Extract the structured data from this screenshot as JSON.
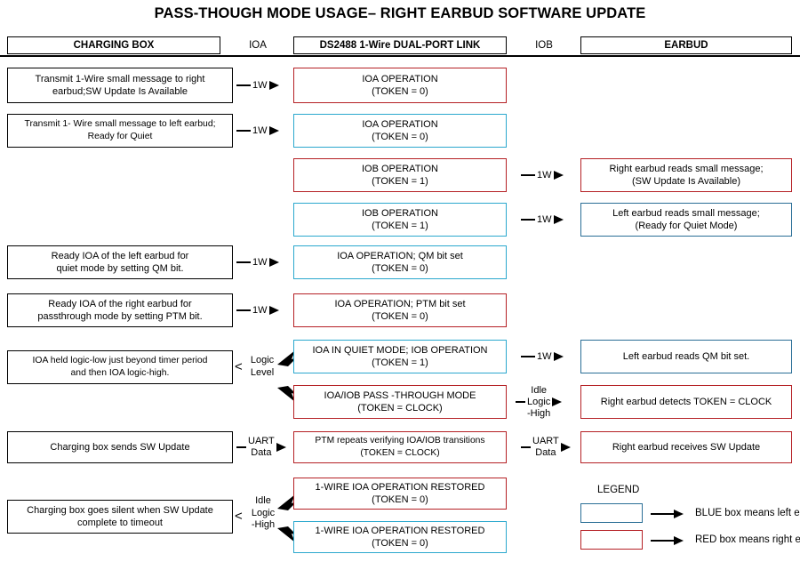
{
  "title": "PASS-THOUGH MODE USAGE– RIGHT EARBUD SOFTWARE UPDATE",
  "header": {
    "charging_box": "CHARGING BOX",
    "ioa": "IOA",
    "link": "DS2488 1-Wire DUAL-PORT LINK",
    "iob": "IOB",
    "earbud": "EARBUD"
  },
  "colors": {
    "red": "#B52025",
    "cyan": "#2BA8CE",
    "steel": "#2A6E96",
    "black": "#000000",
    "background": "#FFFFFF"
  },
  "rows": [
    {
      "left": {
        "line1": "Transmit 1-Wire small message to right",
        "line2": "earbud;SW Update Is Available",
        "color": "black"
      },
      "conn_left": {
        "label": "1W"
      },
      "middle": {
        "line1": "IOA OPERATION",
        "line2": "(TOKEN = 0)",
        "color": "red"
      },
      "conn_right": null,
      "right": null
    },
    {
      "left": {
        "line1": "Transmit 1- Wire small message to left earbud;",
        "line2": "Ready for Quiet",
        "color": "black"
      },
      "conn_left": {
        "label": "1W"
      },
      "middle": {
        "line1": "IOA OPERATION",
        "line2": "(TOKEN = 0)",
        "color": "cyan"
      },
      "conn_right": null,
      "right": null
    },
    {
      "left": null,
      "conn_left": null,
      "middle": {
        "line1": "IOB OPERATION",
        "line2": "(TOKEN = 1)",
        "color": "red"
      },
      "conn_right": {
        "label": "1W"
      },
      "right": {
        "line1": "Right earbud reads small message;",
        "line2": "(SW Update Is Available)",
        "color": "red"
      }
    },
    {
      "left": null,
      "conn_left": null,
      "middle": {
        "line1": "IOB OPERATION",
        "line2": "(TOKEN = 1)",
        "color": "cyan"
      },
      "conn_right": {
        "label": "1W"
      },
      "right": {
        "line1": "Left earbud reads small message;",
        "line2": "(Ready for Quiet Mode)",
        "color": "steel"
      }
    },
    {
      "left": {
        "line1": "Ready IOA of the left earbud for",
        "line2": "quiet mode by setting QM bit.",
        "color": "black"
      },
      "conn_left": {
        "label": "1W"
      },
      "middle": {
        "line1": "IOA OPERATION; QM bit set",
        "line2": "(TOKEN = 0)",
        "color": "cyan"
      },
      "conn_right": null,
      "right": null
    },
    {
      "left": {
        "line1": "Ready IOA of the right earbud for",
        "line2": "passthrough mode by setting PTM bit.",
        "color": "black"
      },
      "conn_left": {
        "label": "1W"
      },
      "middle": {
        "line1": "IOA OPERATION; PTM bit set",
        "line2": "(TOKEN = 0)",
        "color": "red"
      },
      "conn_right": null,
      "right": null
    }
  ],
  "branch_group_1": {
    "left_box": {
      "line1": "IOA held logic-low just beyond timer period",
      "line2": "and then IOA logic-high.",
      "color": "black"
    },
    "marker": "<",
    "label_lines": [
      "Logic",
      "Level"
    ],
    "top": {
      "middle": {
        "line1": "IOA IN QUIET MODE; IOB OPERATION",
        "line2": "(TOKEN = 1)",
        "color": "cyan"
      },
      "conn_right": {
        "label": "1W"
      },
      "right": {
        "line1": "Left earbud reads QM bit set.",
        "line2": "",
        "color": "steel"
      }
    },
    "bottom": {
      "middle": {
        "line1": "IOA/IOB PASS -THROUGH MODE",
        "line2": "(TOKEN = CLOCK)",
        "color": "red"
      },
      "conn_right": {
        "label_lines": [
          "Idle",
          "Logic",
          "-High"
        ]
      },
      "right": {
        "line1": "Right earbud detects TOKEN = CLOCK",
        "line2": "",
        "color": "red"
      }
    }
  },
  "uart_row": {
    "left": {
      "line1": "Charging box sends SW Update",
      "line2": "",
      "color": "black"
    },
    "conn_left": {
      "label_lines": [
        "UART",
        "Data"
      ]
    },
    "middle": {
      "line1": "PTM repeats verifying IOA/IOB transitions",
      "line2": "(TOKEN = CLOCK)",
      "color": "red"
    },
    "conn_right": {
      "label_lines": [
        "UART",
        "Data"
      ]
    },
    "right": {
      "line1": "Right earbud receives  SW Update",
      "line2": "",
      "color": "red"
    }
  },
  "branch_group_2": {
    "left_box": {
      "line1": "Charging box goes silent when SW Update",
      "line2": "complete to timeout",
      "color": "black"
    },
    "marker": "<",
    "label_lines": [
      "Idle",
      "Logic",
      "-High"
    ],
    "top": {
      "middle": {
        "line1": "1-WIRE IOA OPERATION RESTORED",
        "line2": "(TOKEN = 0)",
        "color": "red"
      }
    },
    "bottom": {
      "middle": {
        "line1": "1-WIRE IOA OPERATION RESTORED",
        "line2": "(TOKEN = 0)",
        "color": "cyan"
      }
    }
  },
  "legend": {
    "title": "LEGEND",
    "items": [
      {
        "color": "steel",
        "text": "BLUE box  means left earbud"
      },
      {
        "color": "red",
        "text": "RED box means right earbud"
      }
    ]
  }
}
